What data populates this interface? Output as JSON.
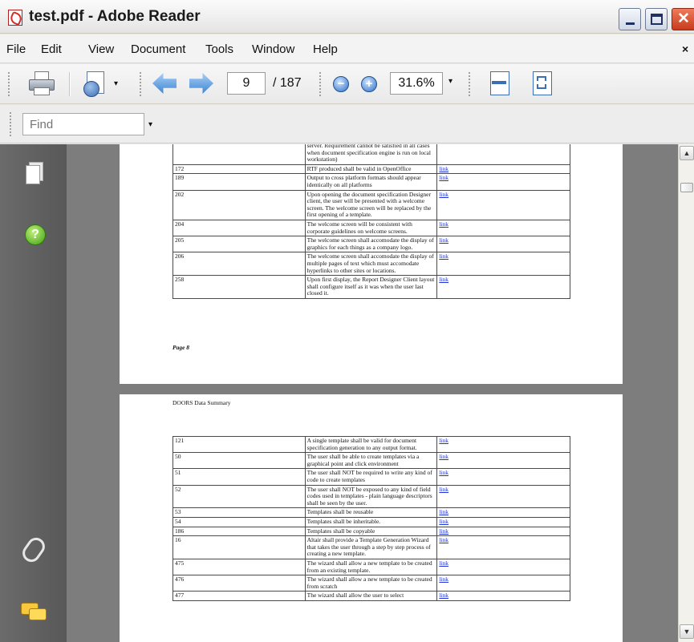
{
  "window": {
    "title": "test.pdf - Adobe Reader",
    "close_glyph": "✕"
  },
  "menu": {
    "items": [
      "File",
      "Edit",
      "View",
      "Document",
      "Tools",
      "Window",
      "Help"
    ],
    "close_glyph": "×"
  },
  "toolbar": {
    "current_page": "9",
    "page_total": "/ 187",
    "zoom": "31.6%",
    "zoom_out_glyph": "−",
    "zoom_in_glyph": "+",
    "dropdown_glyph": "▾"
  },
  "find": {
    "placeholder": "Find"
  },
  "nav": {
    "help_glyph": "?"
  },
  "page1": {
    "rows": [
      {
        "id": "",
        "text": "server. Requirement cannot be satisfied in all cases when document specification engine is run on local workstation)",
        "link": ""
      },
      {
        "id": "172",
        "text": "RTF produced shall be valid in OpenOffice",
        "link": "link"
      },
      {
        "id": "189",
        "text": "Output to cross platform formats should appear identically on all platforms",
        "link": "link"
      },
      {
        "id": "202",
        "text": "Upon opening the document specification Designer client, the user will be presented with a welcome screen. The welcome screen will be replaced by the first opening of a template.",
        "link": "link"
      },
      {
        "id": "204",
        "text": "The welcome screen will be consistent with corporate guidelines on welcome screens.",
        "link": "link"
      },
      {
        "id": "205",
        "text": "The welcome screen shall accomodate the display of graphics for each things as a company logo.",
        "link": "link"
      },
      {
        "id": "206",
        "text": "The welcome screen shall accomodate the display of multiple pages of text which must accomodate hyperlinks to other sites or locations.",
        "link": "link"
      },
      {
        "id": "258",
        "text": "Upon first display, the Report Designer Client layout shall configure itself as it was when the user last closed it.",
        "link": "link"
      }
    ],
    "footer": "Page 8"
  },
  "page2": {
    "header": "DOORS Data Summary",
    "rows": [
      {
        "id": "121",
        "text": "A single template shall be valid for document specification generation to any output format.",
        "link": "link"
      },
      {
        "id": "50",
        "text": "The user shall be able to create templates via a graphical point and click environment",
        "link": "link"
      },
      {
        "id": "51",
        "text": "The user shall NOT be required to write any kind of code to create templates",
        "link": "link"
      },
      {
        "id": "52",
        "text": "The user shall NOT be exposed to any kind of field codes used in templates - plain language descriptors shall be seen by the user.",
        "link": "link"
      },
      {
        "id": "53",
        "text": "Templates shall be reusable",
        "link": "link"
      },
      {
        "id": "54",
        "text": "Templates shall be inheritable.",
        "link": "link"
      },
      {
        "id": "186",
        "text": "Templates shall be copyable",
        "link": "link"
      },
      {
        "id": "16",
        "text": "Altair shall provide a Template Generation Wizard that takes the user through a step by step process of creating a new template.",
        "link": "link"
      },
      {
        "id": "475",
        "text": "The wizard shall allow a new template to be created from an existing template.",
        "link": "link"
      },
      {
        "id": "476",
        "text": "The wizard shall allow a new template to be created from scratch",
        "link": "link"
      },
      {
        "id": "477",
        "text": "The wizard shall allow the user to select",
        "link": "link"
      }
    ]
  },
  "scrollbar": {
    "up_glyph": "▲",
    "down_glyph": "▼"
  }
}
